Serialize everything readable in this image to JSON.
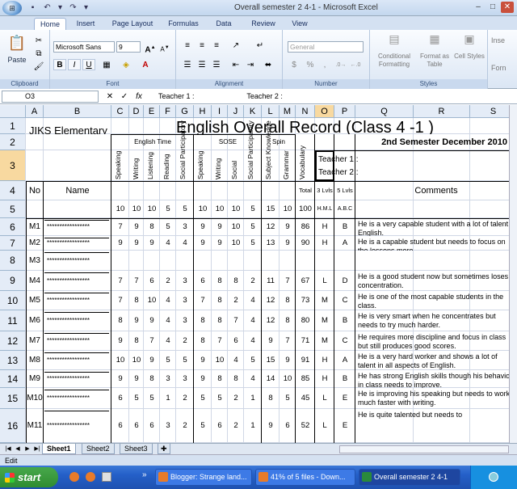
{
  "window": {
    "title": "Overall semester 2  4-1 - Microsoft Excel"
  },
  "tabs": [
    "Home",
    "Insert",
    "Page Layout",
    "Formulas",
    "Data",
    "Review",
    "View"
  ],
  "ribbon": {
    "clipboard": {
      "label": "Clipboard",
      "paste": "Paste"
    },
    "font": {
      "label": "Font",
      "name": "Microsoft Sans",
      "size": "9",
      "bold": "B",
      "italic": "I",
      "underline": "U"
    },
    "alignment": {
      "label": "Alignment"
    },
    "number": {
      "label": "Number",
      "format": "General",
      "currency": "$",
      "percent": "%",
      "comma": ","
    },
    "styles": {
      "label": "Styles",
      "conditional": "Conditional Formatting",
      "table": "Format as Table",
      "cell": "Cell Styles"
    },
    "cells": {
      "insert": "Inse",
      "format": "Forn"
    }
  },
  "formula_bar": {
    "name_box": "O3",
    "content": "Teacher 1 :                          Teacher 2 :"
  },
  "columns": [
    "A",
    "B",
    "C",
    "D",
    "E",
    "F",
    "G",
    "H",
    "I",
    "J",
    "K",
    "L",
    "M",
    "N",
    "O",
    "P",
    "Q",
    "R",
    "S"
  ],
  "sheet": {
    "school": "JIKS Elementary",
    "title": "English Overall Record (Class 4 -1 )",
    "semester": "2nd Semester December 2010",
    "teacher1": "Teacher 1 :",
    "teacher2": "Teacher 2 :",
    "group_english": "English Time",
    "group_sose": "SOSE",
    "group_spin": "Spin",
    "sub_headers": [
      "Speaking",
      "Writing",
      "Listening",
      "Reading",
      "Social Participatory",
      "Speaking",
      "Writing",
      "Social",
      "Social Participatory",
      "Subject Knowledge",
      "Grammar",
      "Vocabulary"
    ],
    "no_label": "No",
    "name_label": "Name",
    "total_label": "Total",
    "lvls3": "3 Lvls",
    "lvls5": "5 Lvls",
    "comments_label": "Comments",
    "max_row": [
      "10",
      "10",
      "10",
      "5",
      "5",
      "10",
      "10",
      "10",
      "5",
      "15",
      "10",
      "100",
      "H.M.L",
      "A.B.C"
    ],
    "students": [
      {
        "no": "M1",
        "name": "*****************",
        "scores": [
          "7",
          "9",
          "8",
          "5",
          "3",
          "9",
          "9",
          "10",
          "5",
          "12",
          "9",
          "86",
          "H",
          "B"
        ],
        "comment": "He is a very capable student with a lot of talent in English."
      },
      {
        "no": "M2",
        "name": "*****************",
        "scores": [
          "9",
          "9",
          "9",
          "4",
          "4",
          "9",
          "9",
          "10",
          "5",
          "13",
          "9",
          "90",
          "H",
          "A"
        ],
        "comment": "He is a capable student but needs to focus on the lessons more."
      },
      {
        "no": "M3",
        "name": "*****************",
        "scores": [
          "",
          "",
          "",
          "",
          "",
          "",
          "",
          "",
          "",
          "",
          "",
          "",
          "",
          ""
        ],
        "comment": ""
      },
      {
        "no": "M4",
        "name": "*****************",
        "scores": [
          "7",
          "7",
          "6",
          "2",
          "3",
          "6",
          "8",
          "8",
          "2",
          "11",
          "7",
          "67",
          "L",
          "D"
        ],
        "comment": "He is a good student now but sometimes loses concentration."
      },
      {
        "no": "M5",
        "name": "*****************",
        "scores": [
          "7",
          "8",
          "10",
          "4",
          "3",
          "7",
          "8",
          "2",
          "4",
          "12",
          "8",
          "73",
          "M",
          "C"
        ],
        "comment": "He is one of the most capable students in the class."
      },
      {
        "no": "M6",
        "name": "*****************",
        "scores": [
          "8",
          "9",
          "9",
          "4",
          "3",
          "8",
          "8",
          "7",
          "4",
          "12",
          "8",
          "80",
          "M",
          "B"
        ],
        "comment": "He is very smart when he concentrates but needs to try much harder."
      },
      {
        "no": "M7",
        "name": "*****************",
        "scores": [
          "9",
          "8",
          "7",
          "4",
          "2",
          "8",
          "7",
          "6",
          "4",
          "9",
          "7",
          "71",
          "M",
          "C"
        ],
        "comment": "He requires more discipline and focus in class but still produces good scores."
      },
      {
        "no": "M8",
        "name": "*****************",
        "scores": [
          "10",
          "10",
          "9",
          "5",
          "5",
          "9",
          "10",
          "4",
          "5",
          "15",
          "9",
          "91",
          "H",
          "A"
        ],
        "comment": "He is a very hard worker and shows a lot of talent in all aspects of English."
      },
      {
        "no": "M9",
        "name": "*****************",
        "scores": [
          "9",
          "9",
          "8",
          "3",
          "3",
          "9",
          "8",
          "8",
          "4",
          "14",
          "10",
          "85",
          "H",
          "B"
        ],
        "comment": "He has strong English skills though his behavior in class needs to improve."
      },
      {
        "no": "M10",
        "name": "*****************",
        "scores": [
          "6",
          "5",
          "5",
          "1",
          "2",
          "5",
          "5",
          "2",
          "1",
          "8",
          "5",
          "45",
          "L",
          "E"
        ],
        "comment": "He is improving his speaking but needs to work much faster with writing."
      },
      {
        "no": "M11",
        "name": "*****************",
        "scores": [
          "6",
          "6",
          "6",
          "3",
          "2",
          "5",
          "6",
          "2",
          "1",
          "9",
          "6",
          "52",
          "L",
          "E"
        ],
        "comment": "He is quite talented but needs to"
      }
    ]
  },
  "sheet_tabs": [
    "Sheet1",
    "Sheet2",
    "Sheet3"
  ],
  "status": "Edit",
  "taskbar": {
    "start": "start",
    "tasks": [
      "Blogger: Strange land...",
      "41% of 5 files - Down...",
      "Overall semester 2  4-1"
    ]
  }
}
